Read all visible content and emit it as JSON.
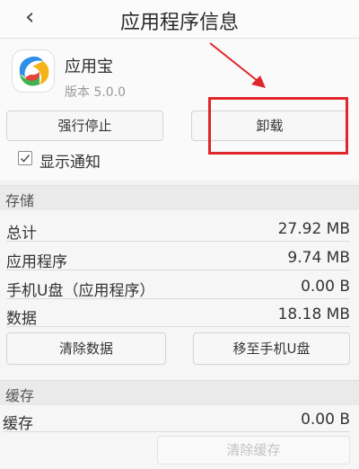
{
  "header": {
    "back_glyph": "‹",
    "title": "应用程序信息"
  },
  "app": {
    "name": "应用宝",
    "version": "版本 5.0.0",
    "icon": "yingyongbao-app-icon"
  },
  "actions": {
    "force_stop": "强行停止",
    "uninstall": "卸载"
  },
  "notifications": {
    "label": "显示通知",
    "checked": true
  },
  "storage": {
    "heading": "存储",
    "rows": [
      {
        "label": "总计",
        "value": "27.92 MB"
      },
      {
        "label": "应用程序",
        "value": "9.74 MB"
      },
      {
        "label": "手机U盘（应用程序）",
        "value": "0.00 B"
      },
      {
        "label": "数据",
        "value": "18.18 MB"
      }
    ],
    "clear_data": "清除数据",
    "move_to_usb": "移至手机U盘"
  },
  "cache": {
    "heading": "缓存",
    "rows": [
      {
        "label": "缓存",
        "value": "0.00 B"
      }
    ],
    "clear_cache": "清除缓存"
  },
  "colors": {
    "annotation_red": "#e0262a"
  }
}
